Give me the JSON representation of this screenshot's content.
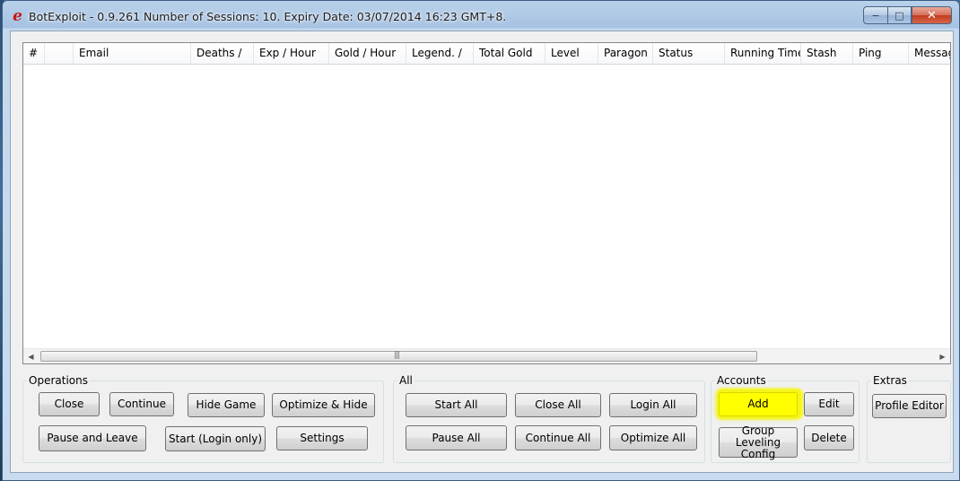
{
  "window": {
    "title": "BotExploit - 0.9.261 Number of Sessions: 10. Expiry Date: 03/07/2014 16:23 GMT+8.",
    "icon": "app-logo-e-icon",
    "caption_buttons": {
      "minimize": "−",
      "maximize": "□",
      "close": "✕"
    }
  },
  "sessions_table": {
    "columns": [
      "#",
      "",
      "Email",
      "Deaths /",
      "Exp / Hour",
      "Gold / Hour",
      "Legend. /",
      "Total Gold",
      "Level",
      "Paragon",
      "Status",
      "Running Time",
      "Stash",
      "Ping",
      "Message"
    ],
    "rows": []
  },
  "scrollbar": {
    "left_arrow": "◀",
    "right_arrow": "▶",
    "grip": "|||"
  },
  "groups": {
    "operations": {
      "legend": "Operations",
      "buttons": [
        "Close",
        "Continue",
        "Hide Game",
        "Optimize & Hide",
        "Pause and Leave",
        "Start (Login only)",
        "Settings"
      ]
    },
    "all": {
      "legend": "All",
      "buttons": [
        "Start All",
        "Close All",
        "Login All",
        "Pause All",
        "Continue All",
        "Optimize All"
      ]
    },
    "accounts": {
      "legend": "Accounts",
      "buttons": [
        "Add",
        "Edit",
        "Group Leveling Config",
        "Delete"
      ],
      "highlight_color": "#ffff00"
    },
    "extras": {
      "legend": "Extras",
      "buttons": [
        "Profile Editor"
      ]
    }
  }
}
